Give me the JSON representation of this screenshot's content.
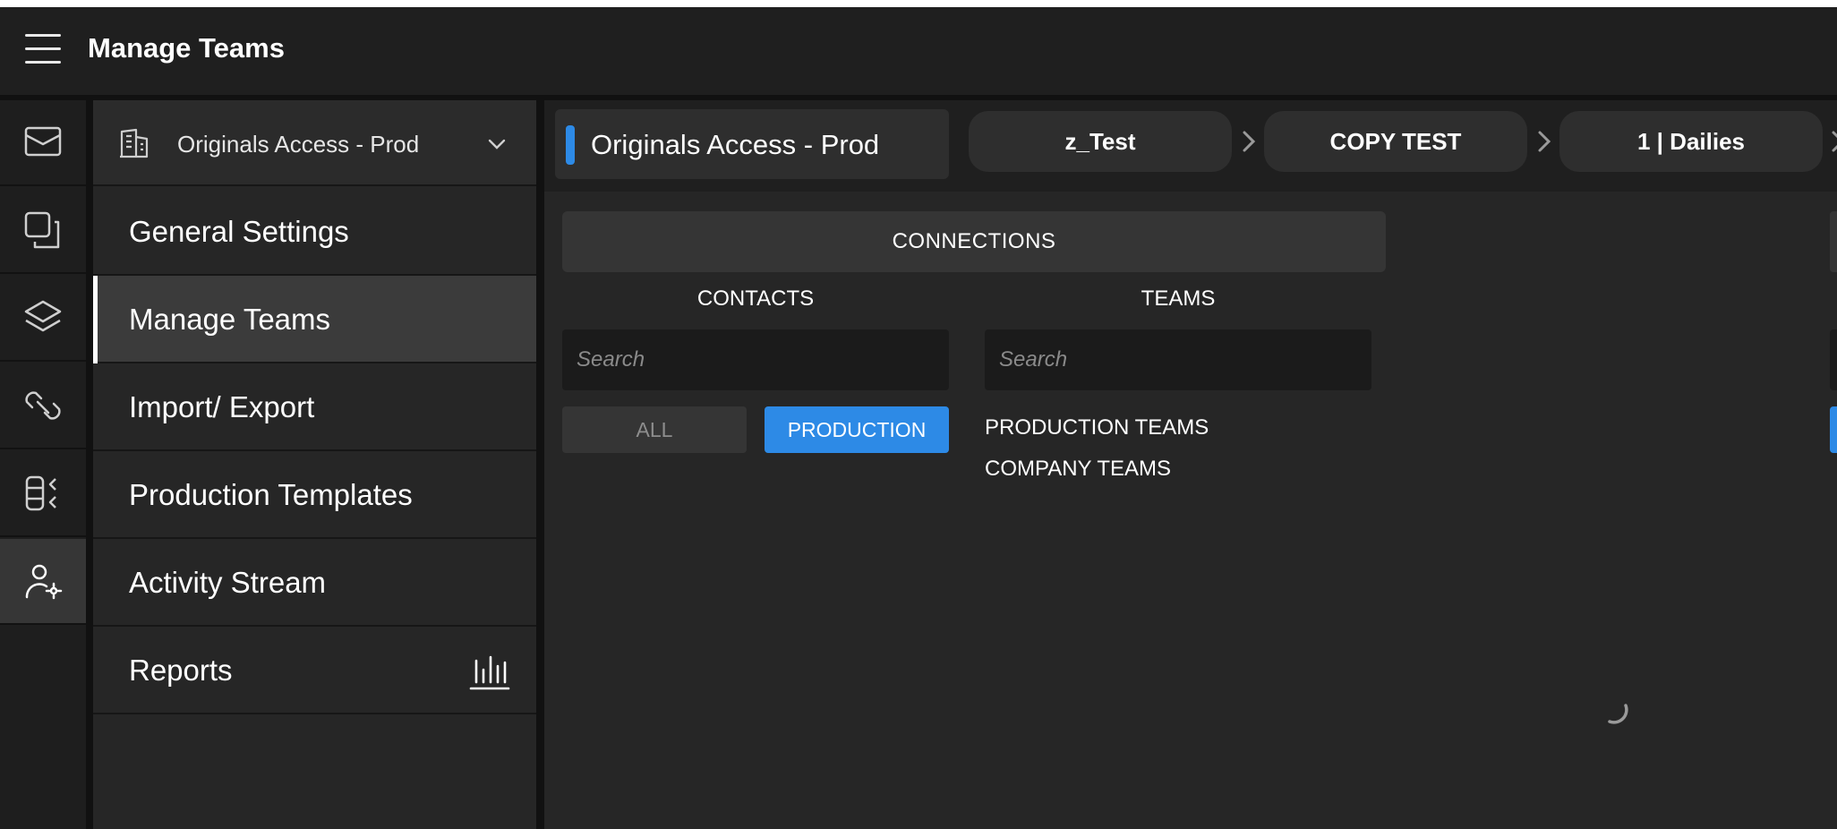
{
  "topbar": {
    "title": "Manage Teams"
  },
  "rail": {
    "icons": [
      "mail-icon",
      "copy-icon",
      "layers-icon",
      "link-icon",
      "list-toggle-icon",
      "user-settings-icon"
    ],
    "active_index": 5
  },
  "nav": {
    "production_selector": {
      "label": "Originals Access - Prod"
    },
    "items": [
      {
        "label": "General Settings"
      },
      {
        "label": "Manage Teams"
      },
      {
        "label": "Import/ Export"
      },
      {
        "label": "Production Templates"
      },
      {
        "label": "Activity Stream"
      },
      {
        "label": "Reports"
      }
    ],
    "active_item": "Manage Teams"
  },
  "breadcrumb": {
    "root": "Originals Access - Prod",
    "items": [
      {
        "label": "z_Test"
      },
      {
        "label": "COPY TEST"
      },
      {
        "label": "1 | Dailies"
      }
    ]
  },
  "main": {
    "connections_label": "CONNECTIONS",
    "contacts": {
      "header": "CONTACTS",
      "search_placeholder": "Search",
      "filters": [
        {
          "label": "ALL",
          "selected": false
        },
        {
          "label": "PRODUCTION",
          "selected": true
        }
      ]
    },
    "teams": {
      "header": "TEAMS",
      "search_placeholder": "Search",
      "groups": [
        {
          "label": "PRODUCTION TEAMS"
        },
        {
          "label": "COMPANY TEAMS"
        }
      ]
    }
  },
  "colors": {
    "accent": "#2d8ae6",
    "background": "#262626",
    "topbar": "#1f1f1f"
  }
}
